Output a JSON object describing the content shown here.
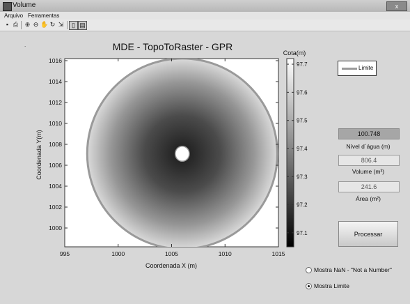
{
  "window": {
    "title": "Volume",
    "close_label": "x"
  },
  "menu": {
    "items": [
      "Arquivo",
      "Ferramentas"
    ]
  },
  "toolbar": {
    "icons": [
      "save-icon",
      "print-icon",
      "zoom-in-icon",
      "zoom-out-icon",
      "pan-icon",
      "rotate-icon",
      "data-cursor-icon",
      "colorbar-icon",
      "legend-icon"
    ],
    "glyphs": [
      "▪",
      "⎙",
      "⊕",
      "⊖",
      "✋",
      "↻",
      "⇲",
      "▯",
      "▤"
    ]
  },
  "chart_data": {
    "type": "heatmap",
    "title": "MDE - TopoToRaster - GPR",
    "xlabel": "Coordenada X (m)",
    "ylabel": "Coordenada Y(m)",
    "xlim": [
      995,
      1015
    ],
    "ylim": [
      998.2,
      1016.2
    ],
    "xticks": [
      995,
      1000,
      1005,
      1010,
      1015
    ],
    "yticks": [
      1000,
      1002,
      1004,
      1006,
      1008,
      1010,
      1012,
      1014,
      1016
    ],
    "x_tick_labels": [
      "995",
      "1000",
      "1005",
      "1010",
      "1015"
    ],
    "y_tick_labels": [
      "1000",
      "1002",
      "1004",
      "1006",
      "1008",
      "1010",
      "1012",
      "1014",
      "1016"
    ],
    "center": [
      1006,
      1007.1
    ],
    "boundary_radius": 9.0,
    "hole_radius": 0.6,
    "colormap": "gray",
    "colorbar": {
      "label": "Cota(m)",
      "range": [
        97.05,
        97.72
      ],
      "ticks": [
        97.1,
        97.2,
        97.3,
        97.4,
        97.5,
        97.6,
        97.7
      ],
      "tick_labels": [
        "97.1",
        "97.2",
        "97.3",
        "97.4",
        "97.5",
        "97.6",
        "97.7"
      ]
    },
    "legend": {
      "entries": [
        "Limite"
      ],
      "position": "top-right"
    },
    "colors": {
      "boundary": "#9a9a9a",
      "hole": "#ffffff"
    }
  },
  "panel": {
    "legend_label": "Limite",
    "nivel_value": "100.748",
    "nivel_label": "Nível d´água (m)",
    "volume_value": "806.4",
    "volume_label": "Volume (m³)",
    "area_value": "241.6",
    "area_label": "Área (m²)",
    "process_label": "Processar",
    "radio_nan_label": "Mostra NaN - \"Not a Number\"",
    "radio_limite_label": "Mostra Limite",
    "radio_nan_checked": false,
    "radio_limite_checked": true
  }
}
